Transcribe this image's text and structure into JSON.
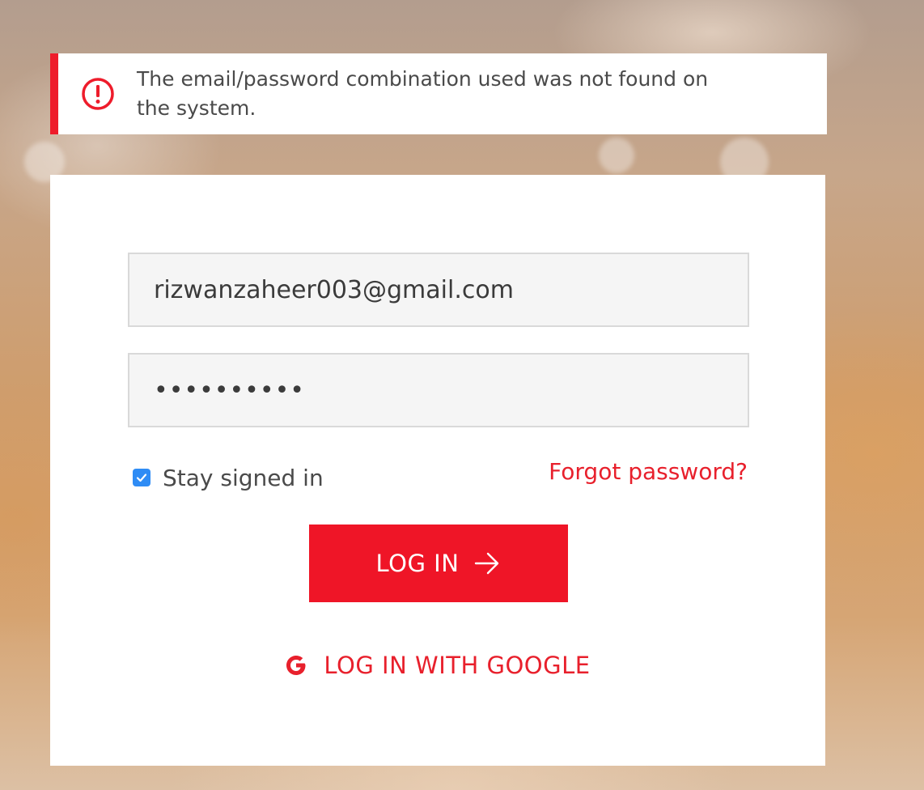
{
  "alert": {
    "icon": "exclamation-circle-icon",
    "message": "The email/password combination used was not found on the system.",
    "color": "#ee1c2b"
  },
  "form": {
    "email": {
      "value": "rizwanzaheer003@gmail.com"
    },
    "password": {
      "value": "••••••••••"
    },
    "stay_signed_in": {
      "label": "Stay signed in",
      "checked": true
    },
    "forgot_password": "Forgot password?",
    "login_button": {
      "label": "LOG IN",
      "icon": "arrow-right-icon"
    },
    "google_login": {
      "label": "LOG IN WITH GOOGLE",
      "icon": "google-icon"
    }
  },
  "colors": {
    "accent": "#ef1527",
    "checkbox": "#2f8cf5"
  }
}
